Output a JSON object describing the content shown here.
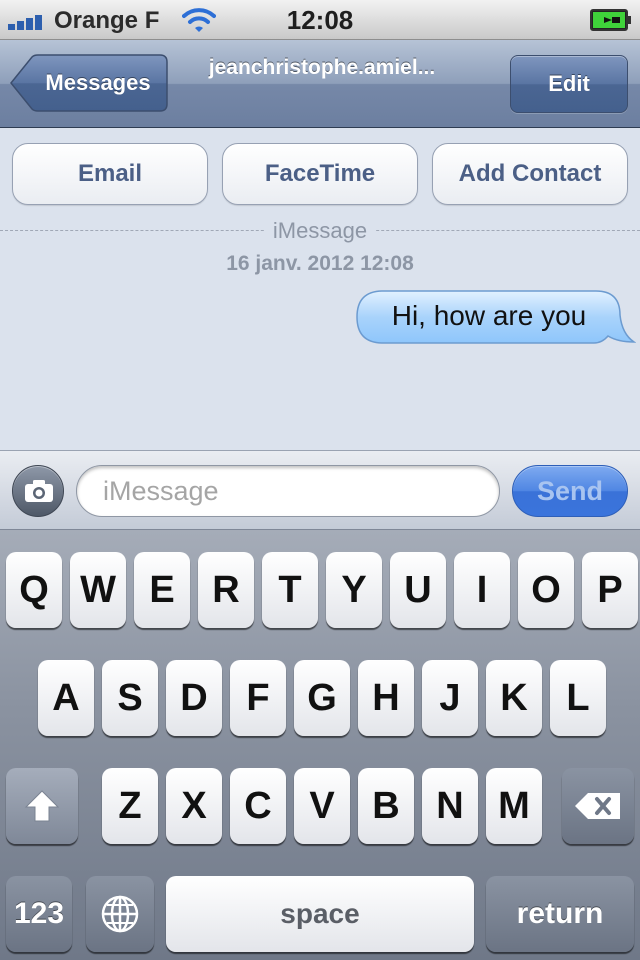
{
  "status_bar": {
    "carrier": "Orange F",
    "time": "12:08",
    "signal_bars": 4,
    "icons": [
      "signal-icon",
      "wifi-icon",
      "battery-charging-icon"
    ],
    "battery_color": "#3fd23a"
  },
  "nav": {
    "back_label": "Messages",
    "title": "jeanchristophe.amiel...",
    "edit_label": "Edit",
    "send_progress": 0.45
  },
  "actions": {
    "email_label": "Email",
    "facetime_label": "FaceTime",
    "add_contact_label": "Add Contact"
  },
  "conversation": {
    "service_label": "iMessage",
    "timestamp": "16 janv. 2012 12:08",
    "messages": [
      {
        "text": "Hi, how are you",
        "direction": "outgoing"
      }
    ],
    "bubble_color": "#a9d3fb"
  },
  "composer": {
    "placeholder": "iMessage",
    "value": "",
    "send_label": "Send",
    "camera_icon": "camera-icon"
  },
  "keyboard": {
    "row1": [
      "Q",
      "W",
      "E",
      "R",
      "T",
      "Y",
      "U",
      "I",
      "O",
      "P"
    ],
    "row2": [
      "A",
      "S",
      "D",
      "F",
      "G",
      "H",
      "J",
      "K",
      "L"
    ],
    "row3": [
      "Z",
      "X",
      "C",
      "V",
      "B",
      "N",
      "M"
    ],
    "numbers_label": "123",
    "space_label": "space",
    "return_label": "return",
    "special_icons": [
      "shift-icon",
      "delete-icon",
      "globe-icon"
    ]
  }
}
